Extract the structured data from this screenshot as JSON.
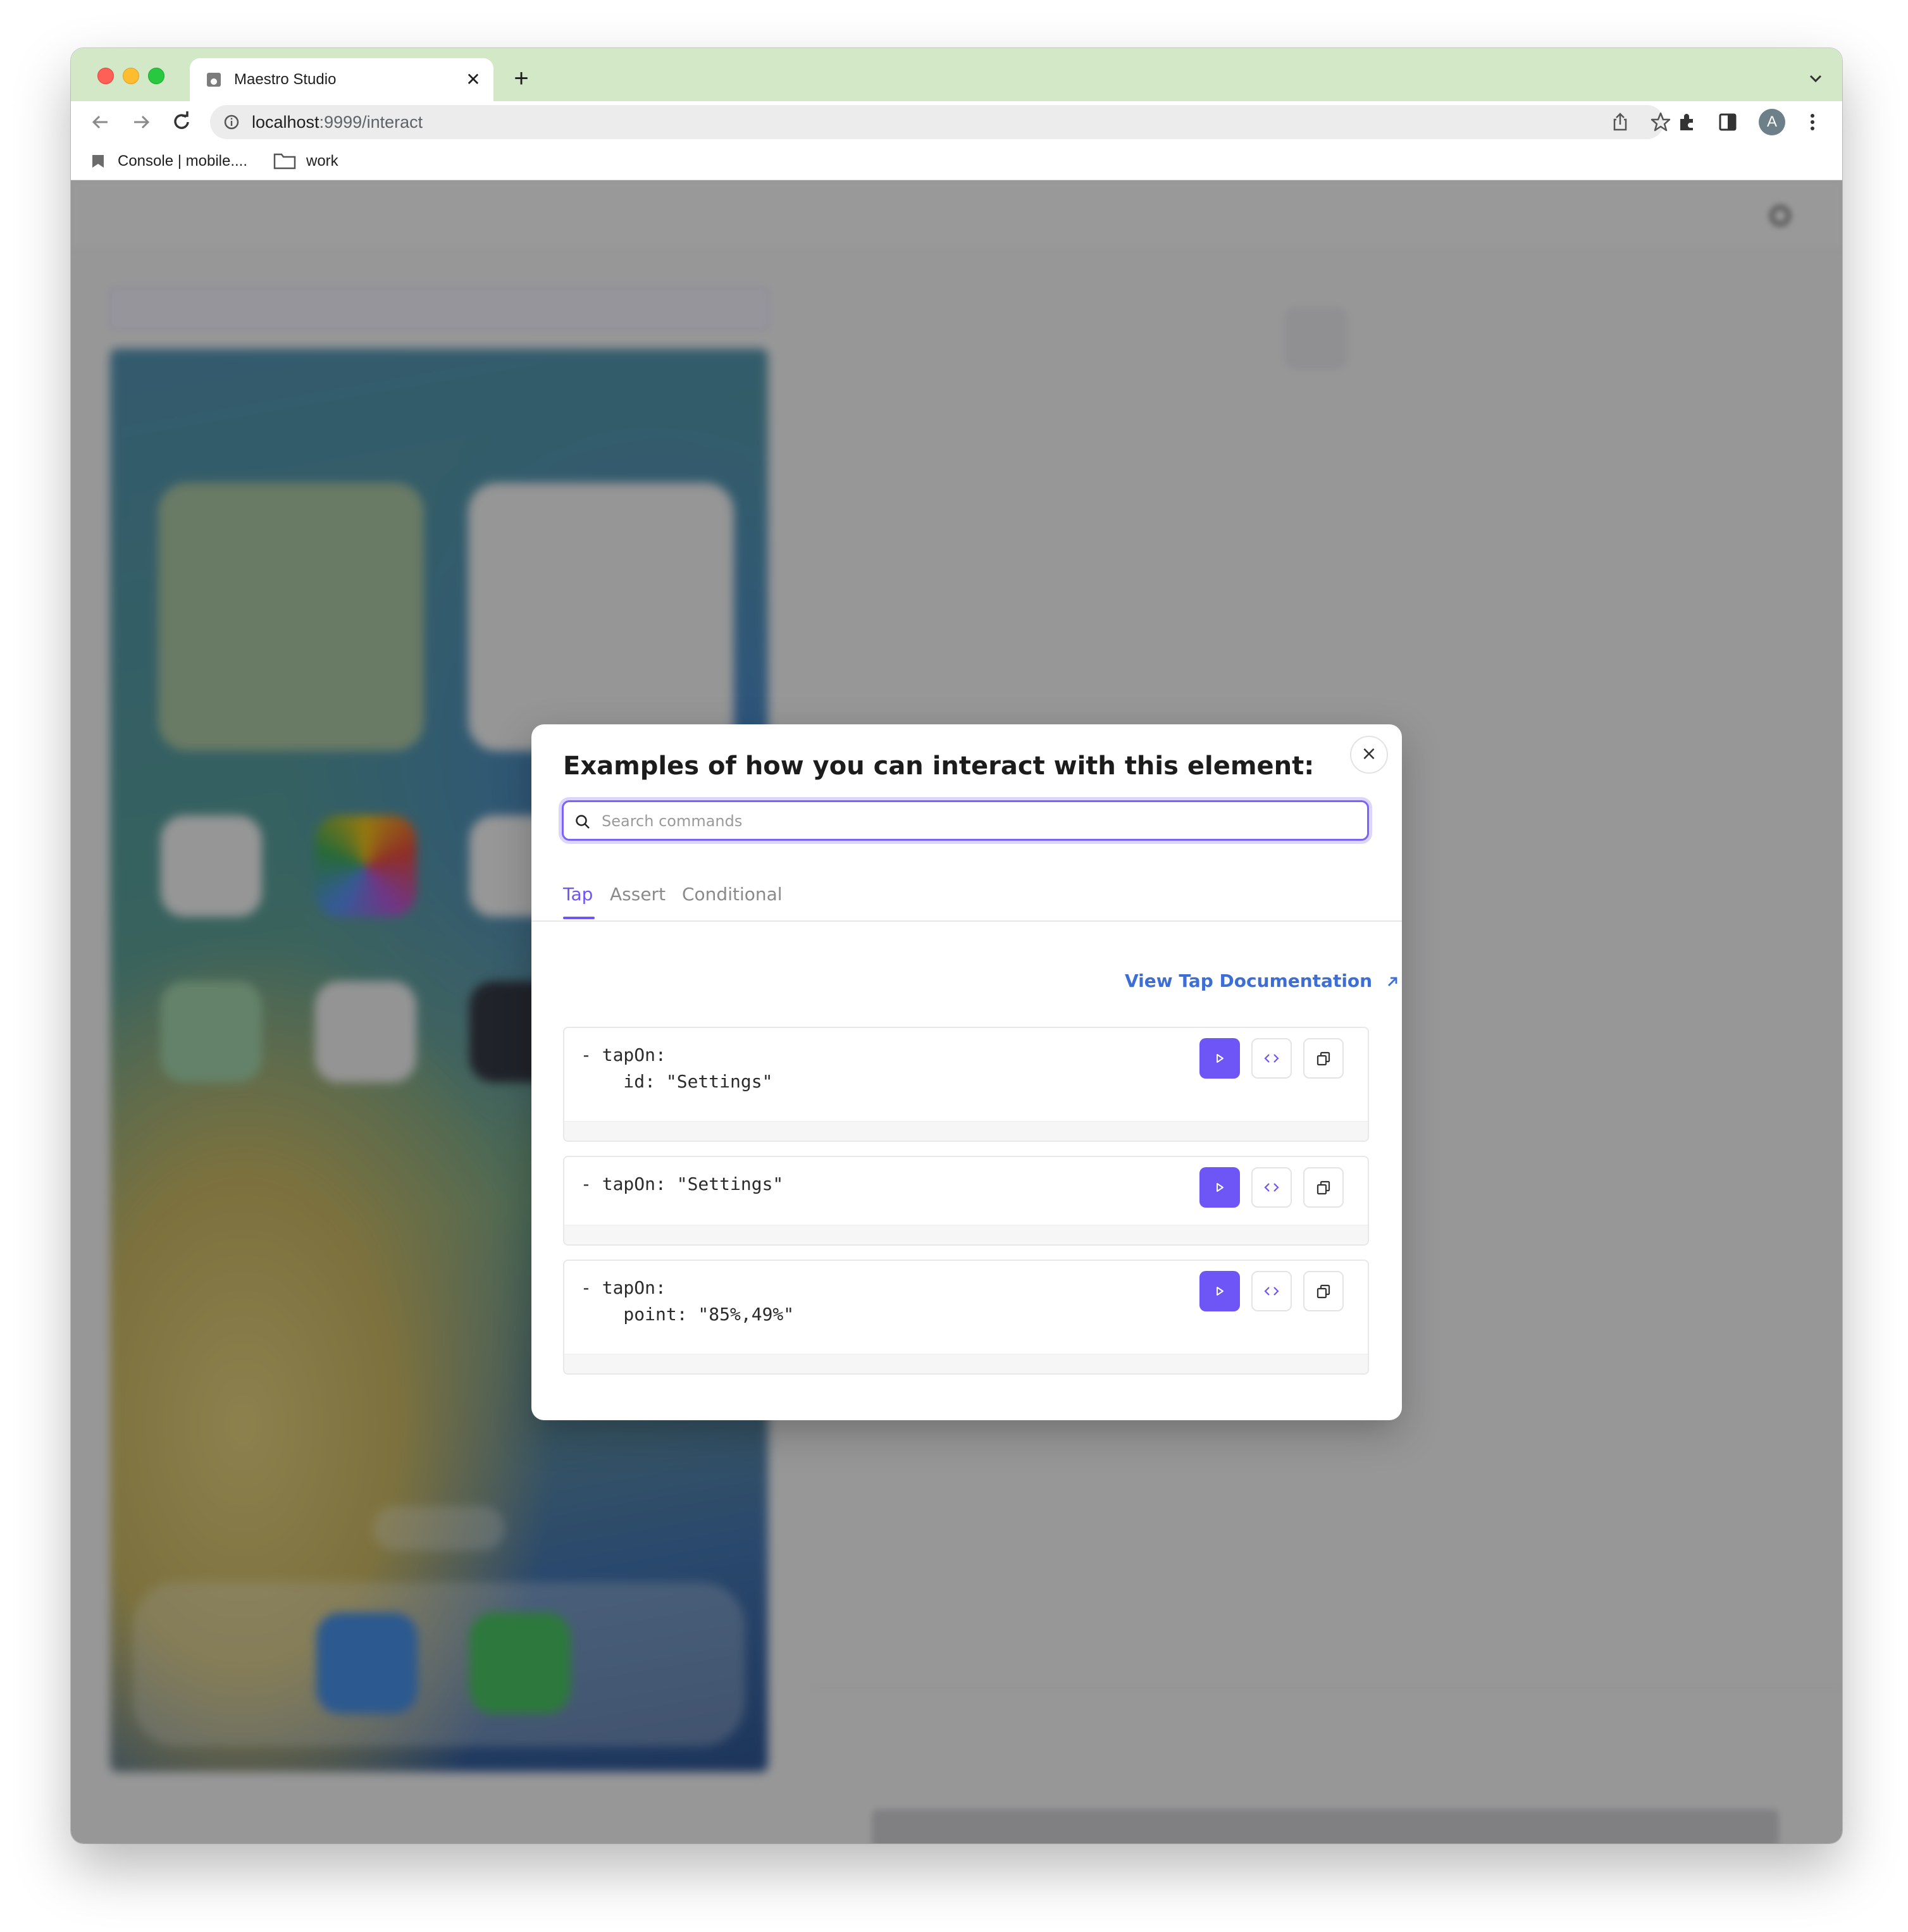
{
  "browser": {
    "tab_title": "Maestro Studio",
    "url_host": "localhost",
    "url_path": ":9999/interact",
    "profile_initial": "A",
    "bookmarks": [
      {
        "label": "Console | mobile...."
      },
      {
        "label": "work"
      }
    ]
  },
  "modal": {
    "title": "Examples of how you can interact with this element:",
    "search_placeholder": "Search commands",
    "close_label": "×",
    "tabs": [
      {
        "label": "Tap",
        "active": true
      },
      {
        "label": "Assert",
        "active": false
      },
      {
        "label": "Conditional",
        "active": false
      }
    ],
    "doc_link": "View Tap Documentation",
    "commands": [
      {
        "code": "- tapOn:\n    id: \"Settings\""
      },
      {
        "code": "- tapOn: \"Settings\""
      },
      {
        "code": "- tapOn:\n    point: \"85%,49%\""
      }
    ]
  },
  "colors": {
    "accent": "#6d56f5",
    "link": "#3d6ed6",
    "tabstrip": "#d3e8c6"
  }
}
